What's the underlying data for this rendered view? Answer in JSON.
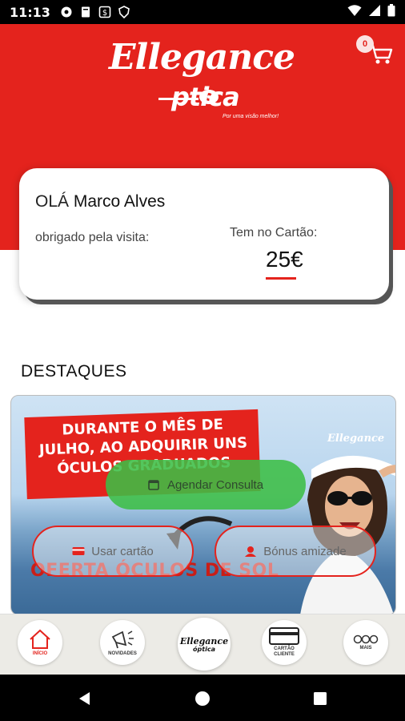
{
  "status_bar": {
    "time": "11:13"
  },
  "brand": {
    "name_top": "Ellegance",
    "name_bottom": "ptica",
    "tagline": "Por uma visão melhor!",
    "color_primary": "#e4231d"
  },
  "cart": {
    "count": "0",
    "icon": "cart-icon"
  },
  "welcome": {
    "greeting": "OLÁ",
    "user_name": "Marco Alves",
    "thanks_text": "obrigado pela visita:",
    "balance_label": "Tem no Cartão:",
    "balance_value": "25€"
  },
  "highlights": {
    "title": "DESTAQUES",
    "promo": {
      "headline": "DURANTE O MÊS DE JULHO, AO ADQUIRIR UNS ÓCULOS GRADUADOS",
      "offer": "OFERTA ÓCULOS DE SOL",
      "watermark": "Ellegance"
    }
  },
  "actions": {
    "consult": "Agendar Consulta",
    "use_card": "Usar cartão",
    "bonus": "Bónus amizade"
  },
  "bottom_nav": {
    "home": "INÍCIO",
    "news": "NOVIDADES",
    "center_top": "Ellegance",
    "center_bottom": "óptica",
    "card_line1": "CARTÃO",
    "card_line2": "CLIENTE",
    "more": "MAIS"
  }
}
